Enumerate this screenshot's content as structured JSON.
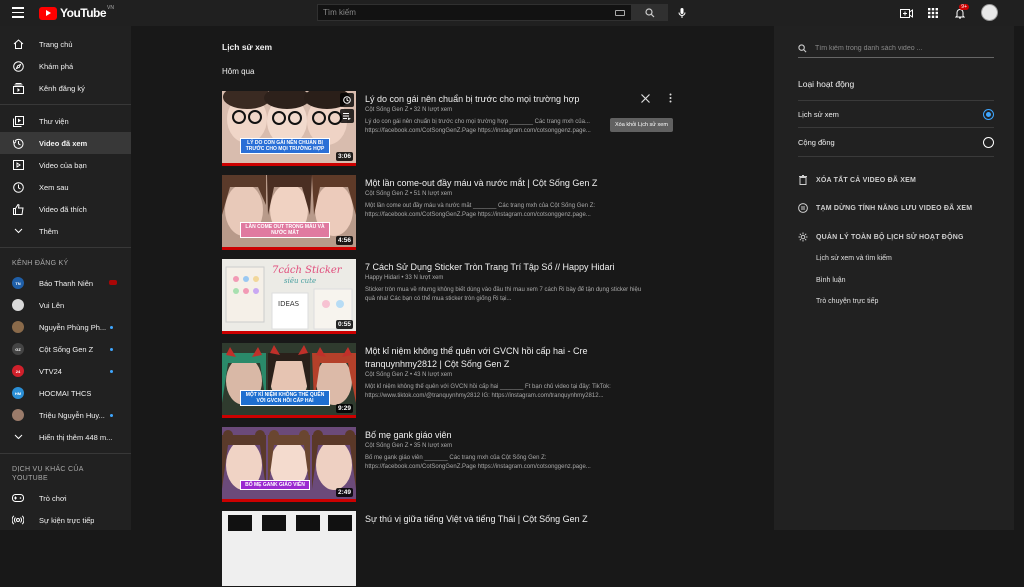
{
  "header": {
    "logo_text": "YouTube",
    "logo_region": "VN",
    "search_placeholder": "Tìm kiếm",
    "notification_count": "9+"
  },
  "sidebar": {
    "items": [
      {
        "label": "Trang chủ",
        "icon": "home-icon"
      },
      {
        "label": "Khám phá",
        "icon": "compass-icon"
      },
      {
        "label": "Kênh đăng ký",
        "icon": "subscriptions-icon"
      },
      {
        "label": "Thư viện",
        "icon": "library-icon"
      },
      {
        "label": "Video đã xem",
        "icon": "history-icon"
      },
      {
        "label": "Video của bạn",
        "icon": "your-videos-icon"
      },
      {
        "label": "Xem sau",
        "icon": "watch-later-icon"
      },
      {
        "label": "Video đã thích",
        "icon": "like-icon"
      },
      {
        "label": "Thêm",
        "icon": "chevron-down-icon"
      }
    ],
    "subs_heading": "KÊNH ĐĂNG KÝ",
    "subscriptions": [
      {
        "name": "Báo Thanh Niên",
        "color": "#1f5fa8",
        "abbr": "TN"
      },
      {
        "name": "Vui Lên",
        "color": "#d9d9d9",
        "abbr": ""
      },
      {
        "name": "Nguyễn Phùng Ph...",
        "color": "#8a6a4a",
        "abbr": ""
      },
      {
        "name": "Cột Sống Gen Z",
        "color": "#444444",
        "abbr": "GZ"
      },
      {
        "name": "VTV24",
        "color": "#d0202b",
        "abbr": "24"
      },
      {
        "name": "HOCMAI THCS",
        "color": "#2b8fd6",
        "abbr": "HM"
      },
      {
        "name": "Triệu Nguyễn Huy...",
        "color": "#9a7b6a",
        "abbr": ""
      }
    ],
    "show_more": "Hiển thị thêm 448 m...",
    "more_heading": "DỊCH VỤ KHÁC CỦA YOUTUBE",
    "more_items": [
      {
        "label": "Trò chơi",
        "icon": "gaming-icon"
      },
      {
        "label": "Sự kiện trực tiếp",
        "icon": "live-icon"
      }
    ]
  },
  "main": {
    "page_title": "Lịch sử xem",
    "date_label": "Hôm qua",
    "remove_tooltip": "Xóa khỏi Lịch sử xem",
    "videos": [
      {
        "title": "Lý do con gái nên chuẩn bị trước cho mọi trường hợp",
        "meta": "Cột Sống Gen Z • 32 N lượt xem",
        "desc": "Lý do con gái nên chuẩn bị trước cho mọi trường hợp _______ Các trang mxh của...",
        "desc2": "https://facebook.com/CotSongGenZ.Page https://instagram.com/cotsonggenz.page...",
        "duration": "3:06",
        "caption": "LÝ DO CON GÁI NÊN CHUẨN BỊ TRƯỚC CHO MỌI TRƯỜNG HỢP"
      },
      {
        "title": "Một lần come-out đầy máu và nước mắt | Cột Sống Gen Z",
        "meta": "Cột Sống Gen Z • 51 N lượt xem",
        "desc": "Một lần come out đầy máu và nước mắt _______ Các trang mxh của Cột Sống Gen Z:",
        "desc2": "https://facebook.com/CotSongGenZ.Page https://instagram.com/cotsonggenz.page...",
        "duration": "4:56",
        "caption": "LẦN COME OUT TRONG MÁU VÀ NƯỚC MẮT"
      },
      {
        "title": "7 Cách Sử Dụng Sticker Tròn Trang Trí Tập Sổ // Happy Hidari",
        "meta": "Happy Hidari • 33 N lượt xem",
        "desc": "Sticker tròn mua về nhưng không biết dùng vào đâu thì mau xem 7 cách Ri bày để tận dụng sticker hiệu",
        "desc2": "quả nha! Các bạn có thể mua sticker tròn giống Ri tại...",
        "duration": "0:55",
        "caption": ""
      },
      {
        "title": "Một kỉ niệm không thể quên với GVCN hồi cấp hai - Cre tranquynhmy2812 | Cột Sống Gen Z",
        "meta": "Cột Sống Gen Z • 43 N lượt xem",
        "desc": "Một kỉ niệm không thể quên với GVCN hồi cấp hai _______ Ft bạn chủ video tại đây: TikTok:",
        "desc2": "https://www.tiktok.com/@tranquynhmy2812 IG: https://instagram.com/tranquynhmy2812...",
        "duration": "9:29",
        "caption": "MỘT KỈ NIỆM KHÔNG THỂ QUÊN VỚI GVCN HỒI CẤP HAI"
      },
      {
        "title": "Bố mẹ gank giáo viên",
        "meta": "Cột Sống Gen Z • 35 N lượt xem",
        "desc": "Bố mẹ gank giáo viên _______ Các trang mxh của Cột Sống Gen Z:",
        "desc2": "https://facebook.com/CotSongGenZ.Page https://instagram.com/cotsonggenz.page...",
        "duration": "2:49",
        "caption": "BỐ MẸ GANK GIÁO VIÊN"
      },
      {
        "title": "Sự thú vị giữa tiếng Việt và tiếng Thái | Cột Sống Gen Z",
        "meta": "",
        "desc": "",
        "desc2": "",
        "duration": "",
        "caption": ""
      }
    ]
  },
  "rightpanel": {
    "search_placeholder": "Tìm kiếm trong danh sách video ...",
    "activity_heading": "Loại hoạt động",
    "radio_options": [
      {
        "label": "Lịch sử xem",
        "checked": true
      },
      {
        "label": "Cộng đồng",
        "checked": false
      }
    ],
    "actions": [
      {
        "label": "XÓA TẤT CẢ VIDEO ĐÃ XEM",
        "icon": "trash-icon"
      },
      {
        "label": "TẠM DỪNG TÍNH NĂNG LƯU VIDEO ĐÃ XEM",
        "icon": "pause-icon"
      },
      {
        "label": "QUẢN LÝ TOÀN BỘ LỊCH SỬ HOẠT ĐỘNG",
        "icon": "gear-icon"
      }
    ],
    "sub_links": [
      "Lịch sử xem và tìm kiếm",
      "Bình luận",
      "Trò chuyện trực tiếp"
    ]
  }
}
